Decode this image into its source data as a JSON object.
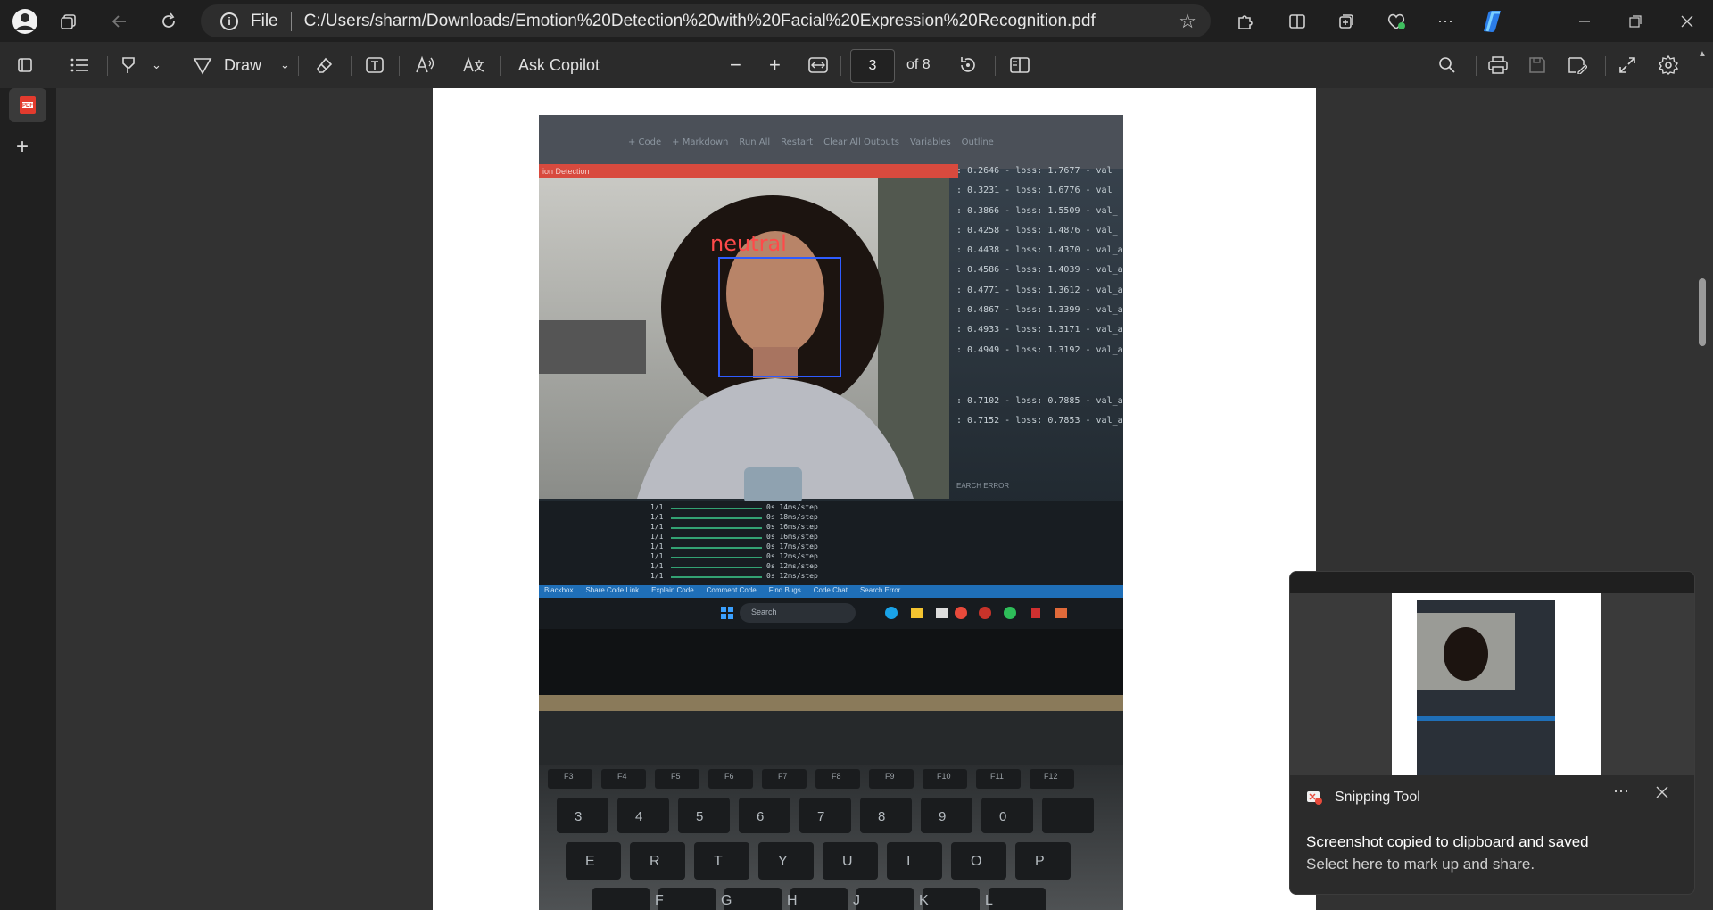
{
  "browser": {
    "address": {
      "scheme_label": "File",
      "url": "C:/Users/sharm/Downloads/Emotion%20Detection%20with%20Facial%20Expression%20Recognition.pdf"
    },
    "icons": [
      "profile-icon",
      "workspaces-icon",
      "back-icon",
      "refresh-icon",
      "favorite-star-icon",
      "extensions-icon",
      "split-screen-icon",
      "collections-icon",
      "browser-essentials-icon",
      "more-icon",
      "copilot-icon",
      "minimize-icon",
      "restore-icon",
      "close-icon"
    ]
  },
  "pdf_toolbar": {
    "draw_label": "Draw",
    "ask_copilot_label": "Ask Copilot",
    "page_current": "3",
    "page_total_label": "of 8"
  },
  "document": {
    "photo": {
      "emotion_label": "neutral",
      "log_lines": [
        ": 0.2646 - loss: 1.7677 - val",
        ": 0.3231 - loss: 1.6776 - val",
        ": 0.3866 - loss: 1.5509 - val_",
        ": 0.4258 - loss: 1.4876 - val_",
        ": 0.4438 - loss: 1.4370 - val_a",
        ": 0.4586 - loss: 1.4039 - val_a",
        ": 0.4771 - loss: 1.3612 - val_ac",
        ": 0.4867 - loss: 1.3399 - val_ac",
        ": 0.4933 - loss: 1.3171 - val_acc",
        ": 0.4949 - loss: 1.3192 - val_acc",
        ": 0.7102 - loss: 0.7885 - val_accu",
        ": 0.7152 - loss: 0.7853 - val_accu"
      ],
      "search_error": "EARCH ERROR",
      "step_lines": [
        {
          "count": "1/1",
          "text": "0s 14ms/step"
        },
        {
          "count": "1/1",
          "text": "0s 18ms/step"
        },
        {
          "count": "1/1",
          "text": "0s 16ms/step"
        },
        {
          "count": "1/1",
          "text": "0s 16ms/step"
        },
        {
          "count": "1/1",
          "text": "0s 17ms/step"
        },
        {
          "count": "1/1",
          "text": "0s 12ms/step"
        },
        {
          "count": "1/1",
          "text": "0s 12ms/step"
        },
        {
          "count": "1/1",
          "text": "0s 12ms/step"
        }
      ],
      "notebook_toolbar": [
        "+ Code",
        "+ Markdown",
        "Run All",
        "Restart",
        "Clear All Outputs",
        "Variables",
        "Outline"
      ],
      "window_title": "ion Detection",
      "status_bar": [
        "Blackbox",
        "Share Code Link",
        "Explain Code",
        "Comment Code",
        "Find Bugs",
        "Code Chat",
        "Search Error"
      ],
      "taskbar_search": "Search",
      "keys_row1": [
        "F3",
        "F4",
        "F5",
        "F6",
        "F7",
        "F8",
        "F9",
        "F10",
        "F11",
        "F12"
      ],
      "keys_row2": [
        "3",
        "4",
        "5",
        "6",
        "7",
        "8",
        "9",
        "0"
      ],
      "keys_row3": [
        "E",
        "R",
        "T",
        "Y",
        "U",
        "I",
        "O",
        "P"
      ],
      "keys_row4": [
        "F",
        "G",
        "H",
        "J",
        "K",
        "L"
      ]
    }
  },
  "toast": {
    "app_name": "Snipping Tool",
    "message": "Screenshot copied to clipboard and saved",
    "sub_message": "Select here to mark up and share."
  },
  "colors": {
    "titlebar_bg": "#1f1f1f",
    "toolbar_bg": "#2b2b2b",
    "viewer_bg": "#323232",
    "accent": "#2b7de9",
    "emotion_label_color": "#ff4a4a",
    "face_box_color": "#2f5cff"
  }
}
